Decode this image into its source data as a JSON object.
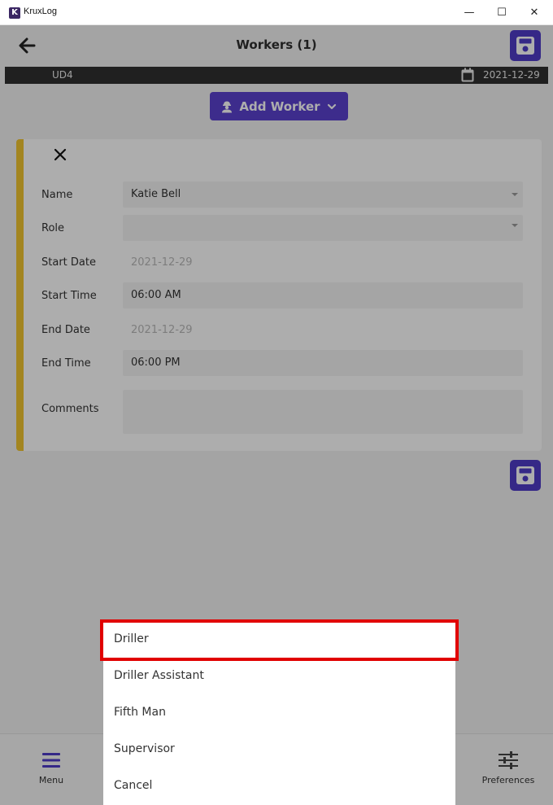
{
  "window": {
    "app_logo": "K",
    "title": "KruxLog",
    "minimize_glyph": "—",
    "maximize_glyph": "☐",
    "close_glyph": "✕"
  },
  "header": {
    "title": "Workers (1)",
    "back_icon": "arrow-left-icon",
    "save_icon": "floppy-disk-icon"
  },
  "infobar": {
    "work_order": "UD4",
    "date": "2021-12-29",
    "calendar_icon": "calendar-icon"
  },
  "add_worker": {
    "label": "Add Worker",
    "icon": "worker-icon",
    "chevron_icon": "chevron-down-icon"
  },
  "worker_card": {
    "accent_color": "#f0c430",
    "fields": {
      "name": {
        "label": "Name",
        "value": "Katie Bell"
      },
      "role": {
        "label": "Role",
        "value": ""
      },
      "start_date": {
        "label": "Start Date",
        "value": "2021-12-29"
      },
      "start_time": {
        "label": "Start Time",
        "value": "06:00 AM"
      },
      "end_date": {
        "label": "End Date",
        "value": "2021-12-29"
      },
      "end_time": {
        "label": "End Time",
        "value": "06:00 PM"
      },
      "comments": {
        "label": "Comments",
        "value": ""
      }
    }
  },
  "footer": {
    "menu_label": "Menu",
    "preferences_label": "Preferences"
  },
  "role_picker": {
    "options": [
      "Driller",
      "Driller Assistant",
      "Fifth Man",
      "Supervisor",
      "Cancel"
    ],
    "highlighted": "Driller"
  },
  "colors": {
    "accent": "#4e3cc8",
    "highlight_border": "#e10000",
    "dark_bar": "#303030"
  }
}
